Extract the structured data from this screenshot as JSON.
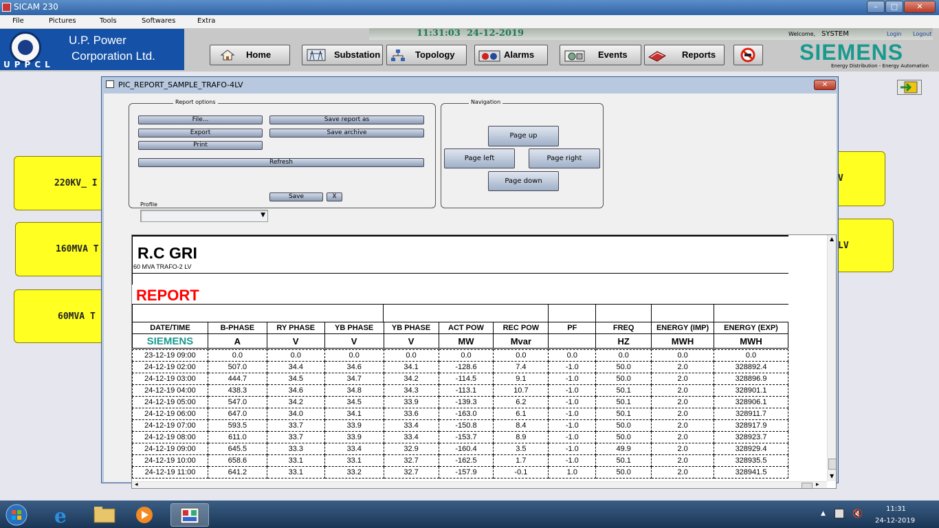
{
  "window": {
    "title": "SICAM 230"
  },
  "menu": [
    "File",
    "Pictures",
    "Tools",
    "Softwares",
    "Extra"
  ],
  "header": {
    "time": "11:31:03",
    "date": "24-12-2019",
    "logo_line1": "U.P. Power",
    "logo_line2": "Corporation Ltd.",
    "logo_abbr": "UPPCL",
    "welcome": "Welcome,",
    "user": "SYSTEM",
    "login": "Login",
    "logout": "Logout",
    "brand": "SIEMENS",
    "brand_tagline": "Energy Distribution - Energy Automation"
  },
  "nav": {
    "home": "Home",
    "substation": "Substation",
    "topology": "Topology",
    "alarms": "Alarms",
    "events": "Events",
    "reports": "Reports"
  },
  "background_buttons": {
    "left_1": "220KV_ I",
    "left_2": "160MVA T",
    "left_3": "60MVA T",
    "right_1": "V",
    "right_2": "LV"
  },
  "dialog": {
    "title": "PIC_REPORT_SAMPLE_TRAFO-4LV",
    "report_options_title": "Report options",
    "file": "File...",
    "save_report_as": "Save report as",
    "export": "Export",
    "save_archive": "Save archive",
    "print": "Print",
    "refresh": "Refresh",
    "profile_label": "Profile",
    "profile_value": "",
    "save": "Save",
    "x": "X",
    "navigation_title": "Navigation",
    "page_up": "Page up",
    "page_left": "Page left",
    "page_right": "Page right",
    "page_down": "Page down"
  },
  "report": {
    "station": "R.C GRI",
    "feeder": "60 MVA TRAFO-2 LV",
    "heading": "REPORT",
    "brand": "SIEMENS",
    "columns": [
      "DATE/TIME",
      "B-PHASE",
      "RY PHASE",
      "YB PHASE",
      "YB PHASE",
      "ACT POW",
      "REC POW",
      "PF",
      "FREQ",
      "ENERGY (IMP)",
      "ENERGY (EXP)"
    ],
    "units": [
      "A",
      "V",
      "V",
      "V",
      "MW",
      "Mvar",
      "",
      "HZ",
      "MWH",
      "MWH"
    ],
    "rows": [
      [
        "23-12-19 09:00",
        "0.0",
        "0.0",
        "0.0",
        "0.0",
        "0.0",
        "0.0",
        "0.0",
        "0.0",
        "0.0",
        "0.0"
      ],
      [
        "24-12-19 02:00",
        "507.0",
        "34.4",
        "34.6",
        "34.1",
        "-128.6",
        "7.4",
        "-1.0",
        "50.0",
        "2.0",
        "328892.4"
      ],
      [
        "24-12-19 03:00",
        "444.7",
        "34.5",
        "34.7",
        "34.2",
        "-114.5",
        "9.1",
        "-1.0",
        "50.0",
        "2.0",
        "328896.9"
      ],
      [
        "24-12-19 04:00",
        "438.3",
        "34.6",
        "34.8",
        "34.3",
        "-113.1",
        "10.7",
        "-1.0",
        "50.1",
        "2.0",
        "328901.1"
      ],
      [
        "24-12-19 05:00",
        "547.0",
        "34.2",
        "34.5",
        "33.9",
        "-139.3",
        "6.2",
        "-1.0",
        "50.1",
        "2.0",
        "328906.1"
      ],
      [
        "24-12-19 06:00",
        "647.0",
        "34.0",
        "34.1",
        "33.6",
        "-163.0",
        "6.1",
        "-1.0",
        "50.1",
        "2.0",
        "328911.7"
      ],
      [
        "24-12-19 07:00",
        "593.5",
        "33.7",
        "33.9",
        "33.4",
        "-150.8",
        "8.4",
        "-1.0",
        "50.0",
        "2.0",
        "328917.9"
      ],
      [
        "24-12-19 08:00",
        "611.0",
        "33.7",
        "33.9",
        "33.4",
        "-153.7",
        "8.9",
        "-1.0",
        "50.0",
        "2.0",
        "328923.7"
      ],
      [
        "24-12-19 09:00",
        "645.5",
        "33.3",
        "33.4",
        "32.9",
        "-160.4",
        "3.5",
        "-1.0",
        "49.9",
        "2.0",
        "328929.4"
      ],
      [
        "24-12-19 10:00",
        "658.6",
        "33.1",
        "33.1",
        "32.7",
        "-162.5",
        "1.7",
        "-1.0",
        "50.1",
        "2.0",
        "328935.5"
      ],
      [
        "24-12-19 11:00",
        "641.2",
        "33.1",
        "33.2",
        "32.7",
        "-157.9",
        "-0.1",
        "1.0",
        "50.0",
        "2.0",
        "328941.5"
      ]
    ]
  },
  "taskbar": {
    "time": "11:31",
    "date": "24-12-2019"
  },
  "colors": {
    "accent": "#199a8e",
    "header_blue": "#1551a6",
    "report_red": "#ff0000",
    "button_yellow": "#ffff22",
    "clock_green": "#1a7a55"
  },
  "icons": [
    "home-icon",
    "substation-icon",
    "topology-icon",
    "alarms-icon",
    "events-icon",
    "reports-icon",
    "stop-icon",
    "windows-start-icon",
    "ie-icon",
    "folder-icon",
    "media-icon",
    "sicam-icon"
  ]
}
